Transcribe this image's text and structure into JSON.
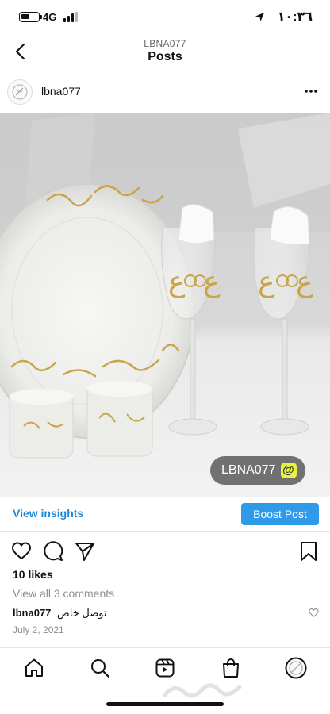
{
  "status_bar": {
    "network": "4G",
    "time": "١٠:٣٦",
    "icons": [
      "battery-icon",
      "signal-icon",
      "location-arrow-icon"
    ]
  },
  "header": {
    "subtitle": "LBNA077",
    "title": "Posts",
    "back_icon": "chevron-left-icon"
  },
  "post": {
    "username": "lbna077",
    "more_icon": "more-horizontal-icon",
    "watermark_text": "LBNA077",
    "watermark_symbol": "@",
    "insights_label": "View insights",
    "boost_label": "Boost Post",
    "likes": "10 likes",
    "comments_label": "View all 3 comments",
    "caption_user": "lbna077",
    "caption_text": "توصل خاص",
    "date": "July 2, 2021",
    "action_icons": [
      "heart-icon",
      "comment-icon",
      "share-icon",
      "bookmark-icon"
    ]
  },
  "bottom_nav": {
    "items": [
      "home-icon",
      "search-icon",
      "reels-icon",
      "shop-icon",
      "profile-icon"
    ]
  },
  "colors": {
    "accent": "#2f9ae8",
    "link": "#1a8ad8",
    "muted": "#8e8e8e",
    "watermark_bg": "#5a5a5a",
    "watermark_at": "#e8f23f"
  }
}
